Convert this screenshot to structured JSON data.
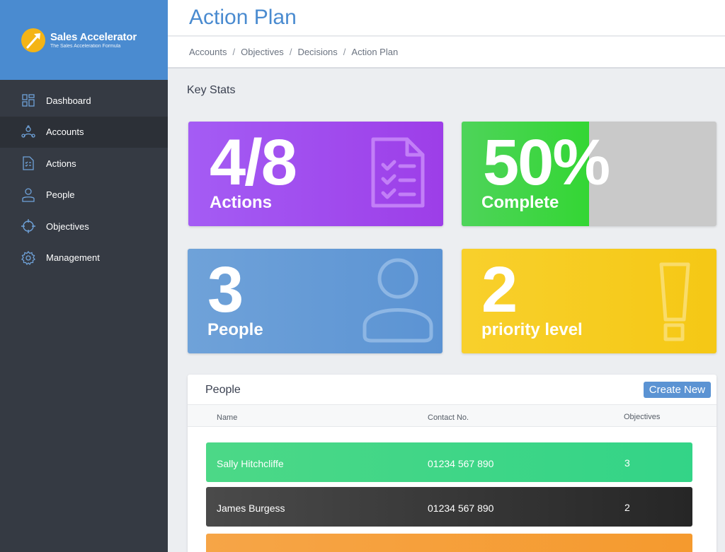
{
  "brand": {
    "name": "Sales Accelerator",
    "tagline": "The Sales Acceleration Formula"
  },
  "sidebar": {
    "items": [
      {
        "label": "Dashboard",
        "icon": "dashboard-icon",
        "active": false
      },
      {
        "label": "Accounts",
        "icon": "accounts-icon",
        "active": true
      },
      {
        "label": "Actions",
        "icon": "actions-icon",
        "active": false
      },
      {
        "label": "People",
        "icon": "people-icon",
        "active": false
      },
      {
        "label": "Objectives",
        "icon": "objectives-icon",
        "active": false
      },
      {
        "label": "Management",
        "icon": "gear-icon",
        "active": false
      }
    ]
  },
  "header": {
    "title": "Action Plan"
  },
  "breadcrumb": [
    "Accounts",
    "Objectives",
    "Decisions",
    "Action Plan"
  ],
  "key_stats": {
    "title": "Key Stats",
    "actions": {
      "value": "4/8",
      "label": "Actions",
      "color": "#a14cf0"
    },
    "complete": {
      "value": "50%",
      "label": "Complete",
      "progress": 0.5,
      "color": "#3dd63f"
    },
    "people": {
      "value": "3",
      "label": "People",
      "color": "#6399d5"
    },
    "priority": {
      "value": "2",
      "label": "priority level",
      "color": "#f6cb1e"
    }
  },
  "people_panel": {
    "title": "People",
    "create_label": "Create New",
    "columns": [
      "Name",
      "Contact No.",
      "Objectives"
    ],
    "rows": [
      {
        "name": "Sally Hitchcliffe",
        "contact": "01234 567 890",
        "objectives": "3",
        "color": "#3fd688"
      },
      {
        "name": "James Burgess",
        "contact": "01234 567 890",
        "objectives": "2",
        "color": "#333333"
      }
    ]
  }
}
